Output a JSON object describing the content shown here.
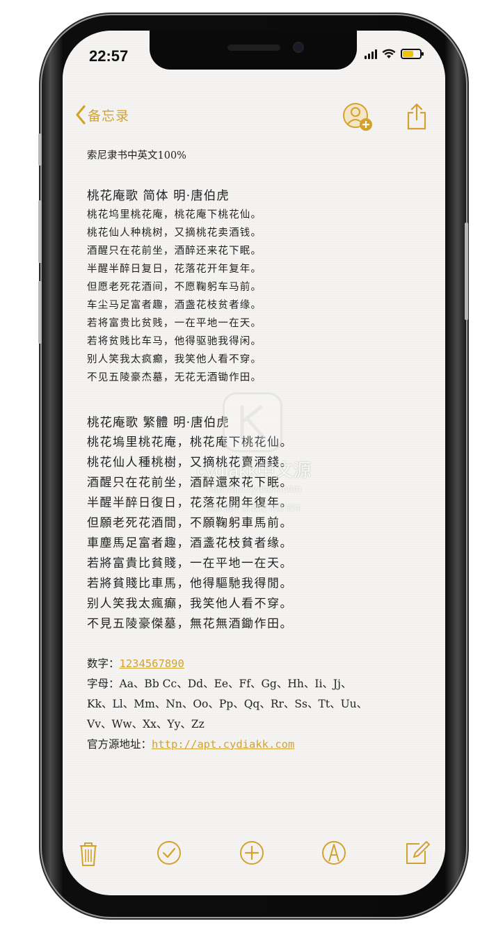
{
  "status_bar": {
    "time": "22:57"
  },
  "nav": {
    "back_label": "备忘录"
  },
  "note": {
    "header": "索尼隶书中英文100%",
    "simplified": {
      "title": "桃花庵歌 简体  明·唐伯虎",
      "lines": [
        "桃花坞里桃花庵，桃花庵下桃花仙。",
        "桃花仙人种桃树，又摘桃花卖酒钱。",
        "酒醒只在花前坐，酒醉还来花下眠。",
        "半醒半醉日复日，花落花开年复年。",
        "但愿老死花酒间，不愿鞠躬车马前。",
        "车尘马足富者趣，酒盏花枝贫者缘。",
        "若将富贵比贫贱，一在平地一在天。",
        "若将贫贱比车马，他得驱驰我得闲。",
        "别人笑我太疯癫，我笑他人看不穿。",
        "不见五陵豪杰墓，无花无酒锄作田。"
      ]
    },
    "traditional": {
      "title": "桃花庵歌 繁體   明·唐伯虎",
      "lines": [
        "桃花塢里桃花庵，桃花庵下桃花仙。",
        "桃花仙人種桃樹，又摘桃花賣酒錢。",
        "酒醒只在花前坐，酒醉還來花下眠。",
        "半醒半醉日復日，花落花開年復年。",
        "但願老死花酒間，不願鞠躬車馬前。",
        "車塵馬足富者趣，酒盞花枝貧者缘。",
        "若將富貴比貧賤，一在平地一在天。",
        "若將貧賤比車馬，他得驅馳我得閒。",
        "别人笑我太瘋癲，我笑他人看不穿。",
        "不見五陵豪傑墓，無花無酒鋤作田。"
      ]
    },
    "digits_label": "数字：",
    "digits_value": "1234567890",
    "letters_lines": [
      "字母：Aa、Bb Cc、Dd、Ee、Ff、Gg、Hh、Ii、Jj、",
      "Kk、Ll、Mm、Nn、Oo、Pp、Qq、Rr、Ss、Tt、Uu、",
      "Vv、Ww、Xx、Yy、Zz"
    ],
    "source_label": "官方源地址：",
    "source_url": "http://apt.cydiakk.com"
  },
  "watermark": {
    "text1": "cydiakk中文源",
    "text2": "http://apt.cydiakk.com",
    "text3": "越狱 插件 源 教程 苹果 软件"
  },
  "colors": {
    "accent": "#d4a22c",
    "paper": "#f5f4f2",
    "text": "#222222"
  },
  "icons": [
    "back-chevron-icon",
    "add-person-icon",
    "share-icon",
    "trash-icon",
    "checklist-icon",
    "add-icon",
    "markup-icon",
    "compose-icon"
  ]
}
